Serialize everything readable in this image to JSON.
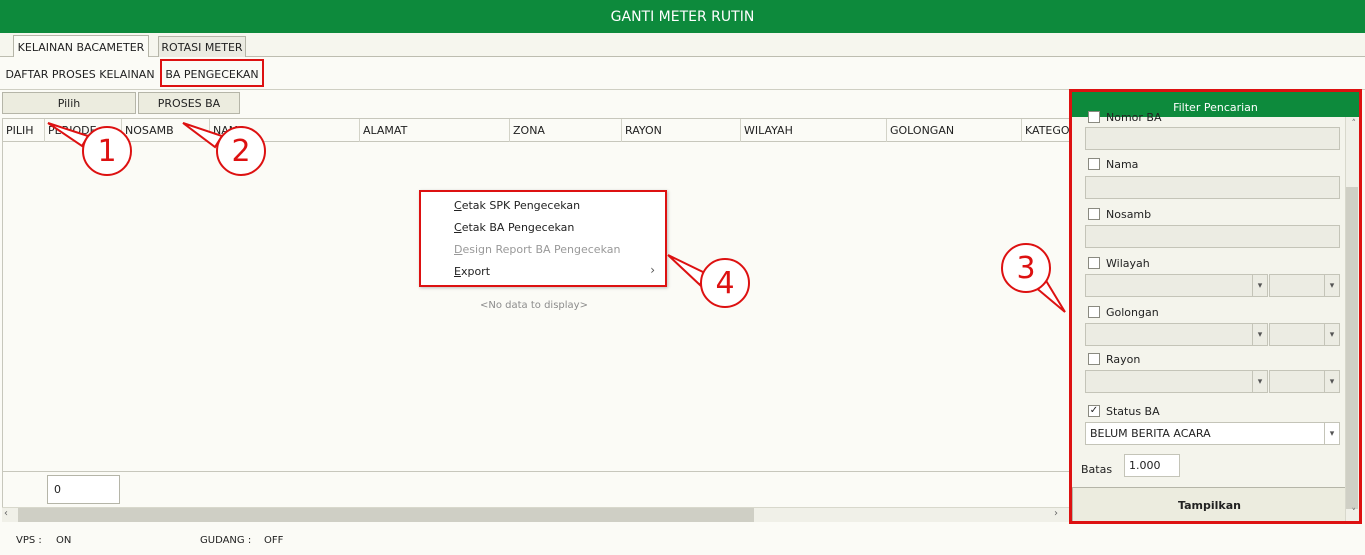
{
  "window": {
    "title": "GANTI METER RUTIN"
  },
  "top_tabs": [
    {
      "label": "KELAINAN BACAMETER"
    },
    {
      "label": "ROTASI METER"
    }
  ],
  "sub_tabs": [
    {
      "label": "DAFTAR PROSES KELAINAN"
    },
    {
      "label": "BA PENGECEKAN"
    }
  ],
  "toolbar": {
    "pilih_label": "Pilih",
    "proses_label": "PROSES BA"
  },
  "grid": {
    "columns": [
      "PILIH",
      "PERIODE",
      "NOSAMB",
      "NAMA",
      "ALAMAT",
      "ZONA",
      "RAYON",
      "WILAYAH",
      "GOLONGAN",
      "KATEGORI"
    ],
    "empty_text": "<No data to display>",
    "footer_count": "0"
  },
  "context_menu": {
    "items": [
      {
        "label": "Cetak SPK Pengecekan",
        "enabled": true,
        "submenu": false
      },
      {
        "label": "Cetak BA Pengecekan",
        "enabled": true,
        "submenu": false
      },
      {
        "label": "Design Report BA Pengecekan",
        "enabled": false,
        "submenu": false
      },
      {
        "label": "Export",
        "enabled": true,
        "submenu": true
      }
    ],
    "submenu_arrow": "›"
  },
  "filter_panel": {
    "title": "Filter Pencarian",
    "fields": {
      "nomor_ba": {
        "label": "Nomor BA",
        "checked": false,
        "value": ""
      },
      "nama": {
        "label": "Nama",
        "checked": false,
        "value": ""
      },
      "nosamb": {
        "label": "Nosamb",
        "checked": false,
        "value": ""
      },
      "wilayah": {
        "label": "Wilayah",
        "checked": false,
        "value": ""
      },
      "golongan": {
        "label": "Golongan",
        "checked": false,
        "value": ""
      },
      "rayon": {
        "label": "Rayon",
        "checked": false,
        "value": ""
      },
      "status_ba": {
        "label": "Status BA",
        "checked": true,
        "value": "BELUM BERITA ACARA"
      }
    },
    "batas_label": "Batas",
    "batas_value": "1.000",
    "submit_label": "Tampilkan",
    "check_glyph": "✓"
  },
  "status_bar": {
    "vps_label": "VPS :",
    "vps_value": "ON",
    "gudang_label": "GUDANG :",
    "gudang_value": "OFF"
  },
  "annotations": {
    "callouts": [
      "1",
      "2",
      "3",
      "4"
    ]
  },
  "colors": {
    "brand_green": "#0d8a3c",
    "highlight_red": "#dd1111"
  }
}
